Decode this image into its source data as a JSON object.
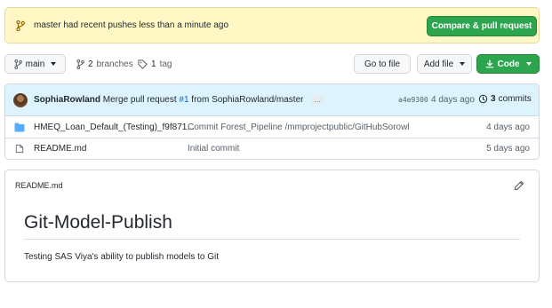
{
  "banner": {
    "message": "master had recent pushes less than a minute ago",
    "action": "Compare & pull request",
    "icon": "git-branch-icon"
  },
  "toolbar": {
    "branch": "main",
    "branches_count": "2",
    "branches_label": "branches",
    "tags_count": "1",
    "tags_label": "tag",
    "goto_file": "Go to file",
    "add_file": "Add file",
    "code": "Code"
  },
  "latest_commit": {
    "author": "SophiaRowland",
    "message_prefix": "Merge pull request",
    "pr_ref": "#1",
    "message_suffix": "from SophiaRowland/master",
    "ellipsis": "…",
    "sha": "a4e9300",
    "when": "4 days ago",
    "commits_count": "3",
    "commits_label": "commits"
  },
  "files": [
    {
      "type": "directory",
      "name": "HMEQ_Loan_Default_(Testing)_f9f871...",
      "message": "Commit Forest_Pipeline /mmprojectpublic/GitHubSorowl",
      "age": "4 days ago"
    },
    {
      "type": "file",
      "name": "README.md",
      "message": "Initial commit",
      "age": "5 days ago"
    }
  ],
  "readme": {
    "header": "README.md",
    "title": "Git-Model-Publish",
    "body": "Testing SAS Viya's ability to publish models to Git"
  },
  "colors": {
    "accent_green": "#2da44e",
    "banner_bg": "#fff8c5",
    "commit_bar_bg": "#ddf4ff",
    "folder": "#54aeff",
    "link": "#0969da"
  }
}
